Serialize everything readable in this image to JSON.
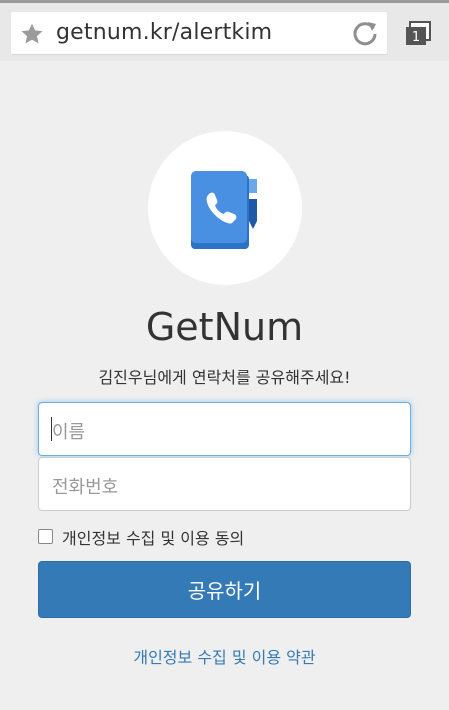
{
  "browser": {
    "url": "getnum.kr/alertkim",
    "tab_count": "1"
  },
  "app": {
    "title": "GetNum",
    "subtitle": "김진우님에게 연락처를 공유해주세요!"
  },
  "form": {
    "name_placeholder": "이름",
    "phone_placeholder": "전화번호",
    "consent_label": "개인정보 수집 및 이용 동의",
    "consent_checked": false,
    "submit_label": "공유하기",
    "terms_link": "개인정보 수집 및 이용 약관"
  },
  "colors": {
    "primary": "#337ab7",
    "logo_blue": "#4a90e2",
    "logo_dark": "#1e5aa8"
  }
}
